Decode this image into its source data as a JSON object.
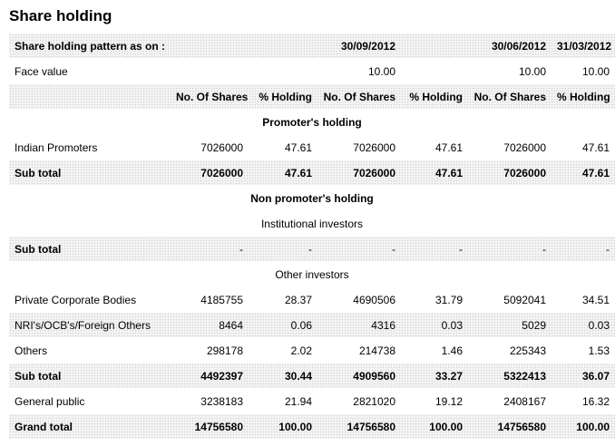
{
  "page": {
    "title": "Share holding"
  },
  "pattern_row": {
    "label": "Share holding pattern as on :",
    "dates": [
      "30/09/2012",
      "30/06/2012",
      "31/03/2012"
    ]
  },
  "face_value_row": {
    "label": "Face value",
    "values": [
      "10.00",
      "10.00",
      "10.00"
    ]
  },
  "columns": [
    "No. Of Shares",
    "% Holding",
    "No. Of Shares",
    "% Holding",
    "No. Of Shares",
    "% Holding"
  ],
  "sections": {
    "promoter": "Promoter's holding",
    "non_promoter": "Non promoter's holding",
    "institutional": "Institutional investors",
    "other": "Other investors"
  },
  "rows": {
    "indian_promoters": {
      "label": "Indian Promoters",
      "values": [
        "7026000",
        "47.61",
        "7026000",
        "47.61",
        "7026000",
        "47.61"
      ]
    },
    "subtotal_promoter": {
      "label": "Sub total",
      "values": [
        "7026000",
        "47.61",
        "7026000",
        "47.61",
        "7026000",
        "47.61"
      ]
    },
    "subtotal_institutional": {
      "label": "Sub total",
      "values": [
        "-",
        "-",
        "-",
        "-",
        "-",
        "-"
      ]
    },
    "private_corporate": {
      "label": "Private Corporate Bodies",
      "values": [
        "4185755",
        "28.37",
        "4690506",
        "31.79",
        "5092041",
        "34.51"
      ]
    },
    "nri": {
      "label": "NRI's/OCB's/Foreign Others",
      "values": [
        "8464",
        "0.06",
        "4316",
        "0.03",
        "5029",
        "0.03"
      ]
    },
    "others": {
      "label": "Others",
      "values": [
        "298178",
        "2.02",
        "214738",
        "1.46",
        "225343",
        "1.53"
      ]
    },
    "subtotal_other": {
      "label": "Sub total",
      "values": [
        "4492397",
        "30.44",
        "4909560",
        "33.27",
        "5322413",
        "36.07"
      ]
    },
    "general_public": {
      "label": "General public",
      "values": [
        "3238183",
        "21.94",
        "2821020",
        "19.12",
        "2408167",
        "16.32"
      ]
    },
    "grand_total": {
      "label": "Grand total",
      "values": [
        "14756580",
        "100.00",
        "14756580",
        "100.00",
        "14756580",
        "100.00"
      ]
    }
  }
}
